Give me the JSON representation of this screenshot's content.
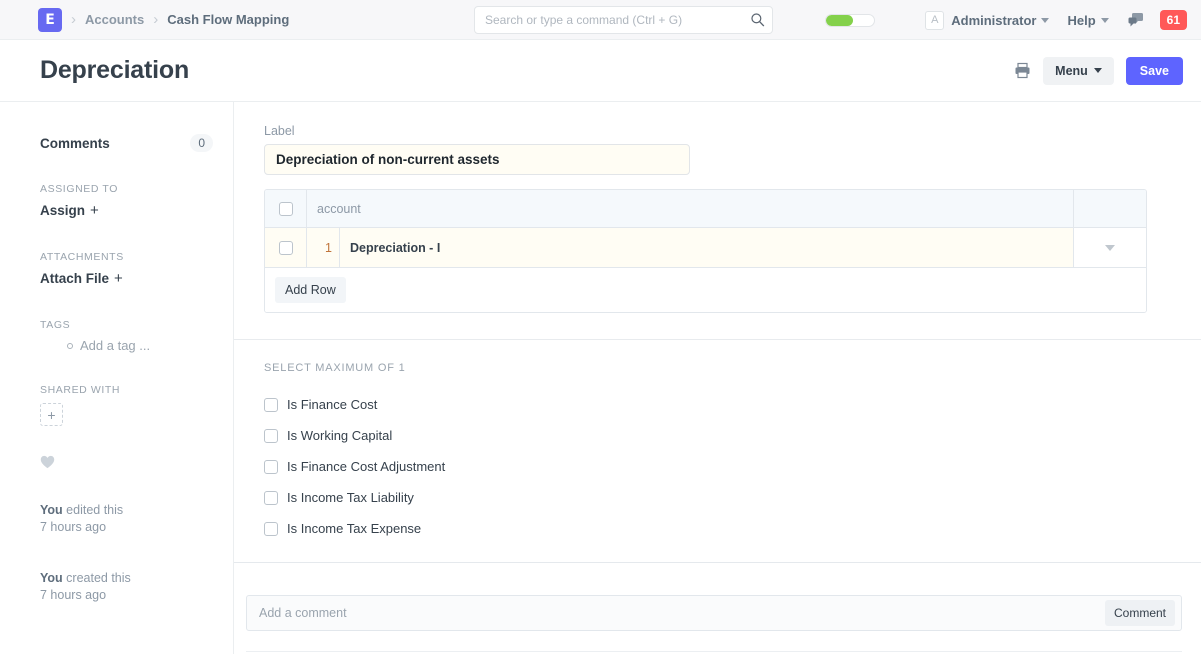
{
  "navbar": {
    "logo_letter": "E",
    "breadcrumbs": [
      {
        "label": "Accounts",
        "active": false
      },
      {
        "label": "Cash Flow Mapping",
        "active": true
      }
    ],
    "separator": "›",
    "search": {
      "placeholder": "Search or type a command (Ctrl + G)",
      "value": "",
      "icon": "search-icon"
    },
    "progress": {
      "percent": 55,
      "color": "#84d14b"
    },
    "avatar_letter": "A",
    "user_menu": "Administrator",
    "help_menu": "Help",
    "chat_icon": "chat-bubbles-icon",
    "notification_count": "61",
    "notification_color": "#ff5858"
  },
  "page_head": {
    "title": "Depreciation",
    "print_icon": "printer-icon",
    "menu_label": "Menu",
    "save_label": "Save",
    "save_color": "#5e64ff"
  },
  "sidebar": {
    "comments_label": "Comments",
    "comments_count": "0",
    "assigned_to_label": "Assigned To",
    "assign_action": "Assign",
    "assign_plus": "+",
    "attachments_label": "Attachments",
    "attach_action": "Attach File",
    "attach_plus": "+",
    "tags_label": "Tags",
    "add_tag": "Add a tag ...",
    "shared_with_label": "Shared With",
    "share_plus": "+",
    "like_icon": "heart-icon",
    "history": [
      {
        "who": "You",
        "what": " edited this",
        "when": "7 hours ago"
      },
      {
        "who": "You",
        "what": " created this",
        "when": "7 hours ago"
      }
    ]
  },
  "main": {
    "label_field": {
      "label": "Label",
      "value": "Depreciation of non-current assets",
      "placeholder": ""
    },
    "grid": {
      "columns": [
        "account"
      ],
      "rows": [
        {
          "index": "1",
          "account": "Depreciation - I"
        }
      ],
      "add_row_label": "Add Row",
      "row_menu_icon": "chevron-down-icon"
    },
    "options_section": {
      "caption": "Select Maximum of 1",
      "options": [
        {
          "label": "Is Finance Cost",
          "checked": false
        },
        {
          "label": "Is Working Capital",
          "checked": false
        },
        {
          "label": "Is Finance Cost Adjustment",
          "checked": false
        },
        {
          "label": "Is Income Tax Liability",
          "checked": false
        },
        {
          "label": "Is Income Tax Expense",
          "checked": false
        }
      ]
    },
    "comment": {
      "placeholder": "Add a comment",
      "value": "",
      "button_label": "Comment"
    }
  }
}
